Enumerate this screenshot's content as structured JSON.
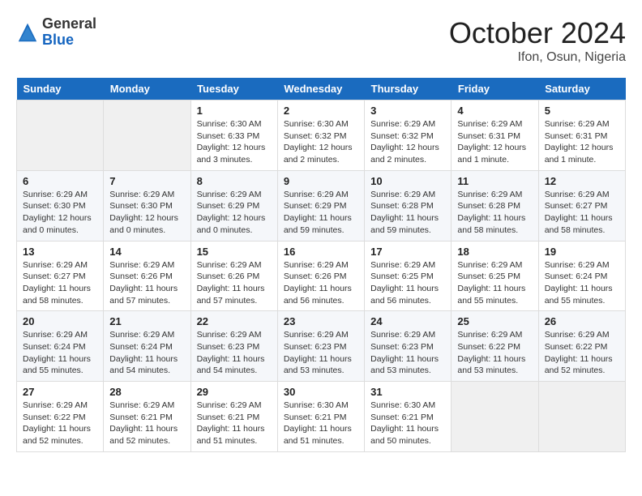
{
  "header": {
    "logo_general": "General",
    "logo_blue": "Blue",
    "month": "October 2024",
    "location": "Ifon, Osun, Nigeria"
  },
  "weekdays": [
    "Sunday",
    "Monday",
    "Tuesday",
    "Wednesday",
    "Thursday",
    "Friday",
    "Saturday"
  ],
  "weeks": [
    [
      {
        "day": "",
        "info": ""
      },
      {
        "day": "",
        "info": ""
      },
      {
        "day": "1",
        "info": "Sunrise: 6:30 AM\nSunset: 6:33 PM\nDaylight: 12 hours\nand 3 minutes."
      },
      {
        "day": "2",
        "info": "Sunrise: 6:30 AM\nSunset: 6:32 PM\nDaylight: 12 hours\nand 2 minutes."
      },
      {
        "day": "3",
        "info": "Sunrise: 6:29 AM\nSunset: 6:32 PM\nDaylight: 12 hours\nand 2 minutes."
      },
      {
        "day": "4",
        "info": "Sunrise: 6:29 AM\nSunset: 6:31 PM\nDaylight: 12 hours\nand 1 minute."
      },
      {
        "day": "5",
        "info": "Sunrise: 6:29 AM\nSunset: 6:31 PM\nDaylight: 12 hours\nand 1 minute."
      }
    ],
    [
      {
        "day": "6",
        "info": "Sunrise: 6:29 AM\nSunset: 6:30 PM\nDaylight: 12 hours\nand 0 minutes."
      },
      {
        "day": "7",
        "info": "Sunrise: 6:29 AM\nSunset: 6:30 PM\nDaylight: 12 hours\nand 0 minutes."
      },
      {
        "day": "8",
        "info": "Sunrise: 6:29 AM\nSunset: 6:29 PM\nDaylight: 12 hours\nand 0 minutes."
      },
      {
        "day": "9",
        "info": "Sunrise: 6:29 AM\nSunset: 6:29 PM\nDaylight: 11 hours\nand 59 minutes."
      },
      {
        "day": "10",
        "info": "Sunrise: 6:29 AM\nSunset: 6:28 PM\nDaylight: 11 hours\nand 59 minutes."
      },
      {
        "day": "11",
        "info": "Sunrise: 6:29 AM\nSunset: 6:28 PM\nDaylight: 11 hours\nand 58 minutes."
      },
      {
        "day": "12",
        "info": "Sunrise: 6:29 AM\nSunset: 6:27 PM\nDaylight: 11 hours\nand 58 minutes."
      }
    ],
    [
      {
        "day": "13",
        "info": "Sunrise: 6:29 AM\nSunset: 6:27 PM\nDaylight: 11 hours\nand 58 minutes."
      },
      {
        "day": "14",
        "info": "Sunrise: 6:29 AM\nSunset: 6:26 PM\nDaylight: 11 hours\nand 57 minutes."
      },
      {
        "day": "15",
        "info": "Sunrise: 6:29 AM\nSunset: 6:26 PM\nDaylight: 11 hours\nand 57 minutes."
      },
      {
        "day": "16",
        "info": "Sunrise: 6:29 AM\nSunset: 6:26 PM\nDaylight: 11 hours\nand 56 minutes."
      },
      {
        "day": "17",
        "info": "Sunrise: 6:29 AM\nSunset: 6:25 PM\nDaylight: 11 hours\nand 56 minutes."
      },
      {
        "day": "18",
        "info": "Sunrise: 6:29 AM\nSunset: 6:25 PM\nDaylight: 11 hours\nand 55 minutes."
      },
      {
        "day": "19",
        "info": "Sunrise: 6:29 AM\nSunset: 6:24 PM\nDaylight: 11 hours\nand 55 minutes."
      }
    ],
    [
      {
        "day": "20",
        "info": "Sunrise: 6:29 AM\nSunset: 6:24 PM\nDaylight: 11 hours\nand 55 minutes."
      },
      {
        "day": "21",
        "info": "Sunrise: 6:29 AM\nSunset: 6:24 PM\nDaylight: 11 hours\nand 54 minutes."
      },
      {
        "day": "22",
        "info": "Sunrise: 6:29 AM\nSunset: 6:23 PM\nDaylight: 11 hours\nand 54 minutes."
      },
      {
        "day": "23",
        "info": "Sunrise: 6:29 AM\nSunset: 6:23 PM\nDaylight: 11 hours\nand 53 minutes."
      },
      {
        "day": "24",
        "info": "Sunrise: 6:29 AM\nSunset: 6:23 PM\nDaylight: 11 hours\nand 53 minutes."
      },
      {
        "day": "25",
        "info": "Sunrise: 6:29 AM\nSunset: 6:22 PM\nDaylight: 11 hours\nand 53 minutes."
      },
      {
        "day": "26",
        "info": "Sunrise: 6:29 AM\nSunset: 6:22 PM\nDaylight: 11 hours\nand 52 minutes."
      }
    ],
    [
      {
        "day": "27",
        "info": "Sunrise: 6:29 AM\nSunset: 6:22 PM\nDaylight: 11 hours\nand 52 minutes."
      },
      {
        "day": "28",
        "info": "Sunrise: 6:29 AM\nSunset: 6:21 PM\nDaylight: 11 hours\nand 52 minutes."
      },
      {
        "day": "29",
        "info": "Sunrise: 6:29 AM\nSunset: 6:21 PM\nDaylight: 11 hours\nand 51 minutes."
      },
      {
        "day": "30",
        "info": "Sunrise: 6:30 AM\nSunset: 6:21 PM\nDaylight: 11 hours\nand 51 minutes."
      },
      {
        "day": "31",
        "info": "Sunrise: 6:30 AM\nSunset: 6:21 PM\nDaylight: 11 hours\nand 50 minutes."
      },
      {
        "day": "",
        "info": ""
      },
      {
        "day": "",
        "info": ""
      }
    ]
  ]
}
